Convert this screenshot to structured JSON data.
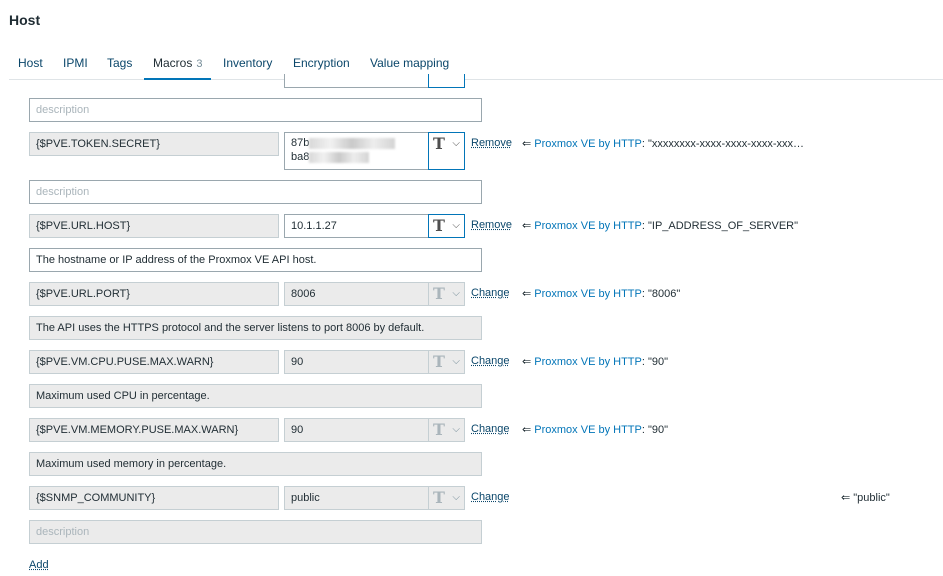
{
  "page": {
    "title": "Host"
  },
  "tabs": [
    {
      "label": "Host"
    },
    {
      "label": "IPMI"
    },
    {
      "label": "Tags"
    },
    {
      "label": "Macros",
      "count": "3"
    },
    {
      "label": "Inventory"
    },
    {
      "label": "Encryption"
    },
    {
      "label": "Value mapping"
    }
  ],
  "macros": [
    {
      "name": "{$PVE.TOKEN.SECRET}",
      "value_line1": "87b",
      "value_line2": "ba8",
      "type_icon": "T",
      "action": "Remove",
      "template": "Proxmox VE by HTTP",
      "inherited_value": "\"xxxxxxxx-xxxx-xxxx-xxxx-xxx…",
      "description": "description"
    },
    {
      "name": "{$PVE.URL.HOST}",
      "value": "10.1.1.27",
      "type_icon": "T",
      "action": "Remove",
      "template": "Proxmox VE by HTTP",
      "inherited_value": "\"IP_ADDRESS_OF_SERVER\"",
      "description": "The hostname or IP address of the Proxmox VE API host."
    },
    {
      "name": "{$PVE.URL.PORT}",
      "value": "8006",
      "type_icon": "T",
      "action": "Change",
      "template": "Proxmox VE by HTTP",
      "inherited_value": "\"8006\"",
      "description": "The API uses the HTTPS protocol and the server listens to port 8006 by default."
    },
    {
      "name": "{$PVE.VM.CPU.PUSE.MAX.WARN}",
      "value": "90",
      "type_icon": "T",
      "action": "Change",
      "template": "Proxmox VE by HTTP",
      "inherited_value": "\"90\"",
      "description": "Maximum used CPU in percentage."
    },
    {
      "name": "{$PVE.VM.MEMORY.PUSE.MAX.WARN}",
      "value": "90",
      "type_icon": "T",
      "action": "Change",
      "template": "Proxmox VE by HTTP",
      "inherited_value": "\"90\"",
      "description": "Maximum used memory in percentage."
    },
    {
      "name": "{$SNMP_COMMUNITY}",
      "value": "public",
      "type_icon": "T",
      "action": "Change",
      "inherited_value": "\"public\"",
      "description": "description"
    }
  ],
  "top_partial": {
    "description": "description"
  },
  "inherit_arrow": "⇐",
  "chevron": "⌵",
  "add_label": "Add",
  "colors": {
    "link": "#0a466a",
    "template_link": "#0275b8",
    "tab_active_border": "#0275b8"
  }
}
